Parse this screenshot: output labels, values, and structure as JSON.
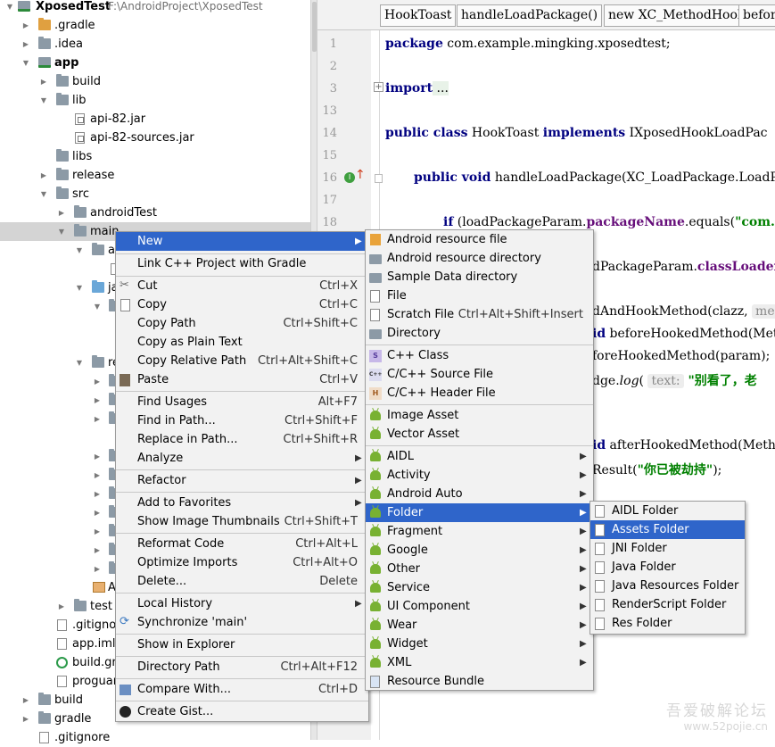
{
  "project": {
    "root_name": "XposedTest",
    "root_path": "F:\\AndroidProject\\XposedTest",
    "rows": [
      {
        "label": ".gradle"
      },
      {
        "label": ".idea"
      },
      {
        "label": "app"
      },
      {
        "label": "build"
      },
      {
        "label": "lib"
      },
      {
        "label": "api-82.jar"
      },
      {
        "label": "api-82-sources.jar"
      },
      {
        "label": "libs"
      },
      {
        "label": "release"
      },
      {
        "label": "src"
      },
      {
        "label": "androidTest"
      },
      {
        "label": "main"
      },
      {
        "label": "a"
      },
      {
        "label": "ja"
      },
      {
        "label": "re"
      },
      {
        "label": "A"
      },
      {
        "label": "test"
      },
      {
        "label": ".gitignor"
      },
      {
        "label": "app.iml"
      },
      {
        "label": "build.gra"
      },
      {
        "label": "proguar"
      },
      {
        "label": "build"
      },
      {
        "label": "gradle"
      },
      {
        "label": ".gitignore"
      }
    ]
  },
  "editor": {
    "tabs": [
      "HookToast",
      "handleLoadPackage()",
      "new XC_MethodHook",
      "before"
    ],
    "line_numbers": [
      "1",
      "2",
      "3",
      "13",
      "14",
      "15",
      "16",
      "17",
      "18"
    ],
    "code": {
      "l1_kw": "package",
      "l1_rest": " com.example.mingking.xposedtest;",
      "l3_kw": "import",
      "l3_rest": " ...",
      "l14_kw1": "public class",
      "l14_mid": " HookToast ",
      "l14_kw2": "implements",
      "l14_rest": " IXposedHookLoadPac",
      "l16_kw": "public void",
      "l16_rest": " handleLoadPackage(XC_LoadPackage.LoadP",
      "l18_kw": "if",
      "l18_a": " (loadPackageParam.",
      "l18_fld": "packageName",
      "l18_b": ".equals(",
      "l18_str": "\"com.",
      "c1_a": "dPackageParam.",
      "c1_fld": "classLoader",
      "c2_a": "dAndHookMethod(clazz, ",
      "c2_hint": "me",
      "c3_kw": "id",
      "c3_rest": " beforeHookedMethod(Met",
      "c4_rest": "foreHookedMethod(param);",
      "c5_a": "dge.",
      "c5_it": "log",
      "c5_b": "( ",
      "c5_hint": "text:",
      "c5_str": " \"别看了，老",
      "c6_kw": "id",
      "c6_rest": " afterHookedMethod(Meth",
      "c7_a": "Result(",
      "c7_str": "\"你已被劫持\"",
      "c7_b": ");"
    }
  },
  "context_menu": {
    "items": [
      {
        "label": "New",
        "shortcut": ""
      },
      {
        "label": "Link C++ Project with Gradle",
        "shortcut": ""
      },
      {
        "label": "Cut",
        "shortcut": "Ctrl+X"
      },
      {
        "label": "Copy",
        "shortcut": "Ctrl+C"
      },
      {
        "label": "Copy Path",
        "shortcut": "Ctrl+Shift+C"
      },
      {
        "label": "Copy as Plain Text",
        "shortcut": ""
      },
      {
        "label": "Copy Relative Path",
        "shortcut": "Ctrl+Alt+Shift+C"
      },
      {
        "label": "Paste",
        "shortcut": "Ctrl+V"
      },
      {
        "label": "Find Usages",
        "shortcut": "Alt+F7"
      },
      {
        "label": "Find in Path...",
        "shortcut": "Ctrl+Shift+F"
      },
      {
        "label": "Replace in Path...",
        "shortcut": "Ctrl+Shift+R"
      },
      {
        "label": "Analyze",
        "shortcut": ""
      },
      {
        "label": "Refactor",
        "shortcut": ""
      },
      {
        "label": "Add to Favorites",
        "shortcut": ""
      },
      {
        "label": "Show Image Thumbnails",
        "shortcut": "Ctrl+Shift+T"
      },
      {
        "label": "Reformat Code",
        "shortcut": "Ctrl+Alt+L"
      },
      {
        "label": "Optimize Imports",
        "shortcut": "Ctrl+Alt+O"
      },
      {
        "label": "Delete...",
        "shortcut": "Delete"
      },
      {
        "label": "Local History",
        "shortcut": ""
      },
      {
        "label": "Synchronize 'main'",
        "shortcut": ""
      },
      {
        "label": "Show in Explorer",
        "shortcut": ""
      },
      {
        "label": "Directory Path",
        "shortcut": "Ctrl+Alt+F12"
      },
      {
        "label": "Compare With...",
        "shortcut": "Ctrl+D"
      },
      {
        "label": "Create Gist...",
        "shortcut": ""
      }
    ]
  },
  "new_submenu": {
    "items": [
      {
        "label": "Android resource file",
        "shortcut": ""
      },
      {
        "label": "Android resource directory",
        "shortcut": ""
      },
      {
        "label": "Sample Data directory",
        "shortcut": ""
      },
      {
        "label": "File",
        "shortcut": ""
      },
      {
        "label": "Scratch File",
        "shortcut": "Ctrl+Alt+Shift+Insert"
      },
      {
        "label": "Directory",
        "shortcut": ""
      },
      {
        "label": "C++ Class",
        "shortcut": ""
      },
      {
        "label": "C/C++ Source File",
        "shortcut": ""
      },
      {
        "label": "C/C++ Header File",
        "shortcut": ""
      },
      {
        "label": "Image Asset",
        "shortcut": ""
      },
      {
        "label": "Vector Asset",
        "shortcut": ""
      },
      {
        "label": "AIDL",
        "shortcut": ""
      },
      {
        "label": "Activity",
        "shortcut": ""
      },
      {
        "label": "Android Auto",
        "shortcut": ""
      },
      {
        "label": "Folder",
        "shortcut": ""
      },
      {
        "label": "Fragment",
        "shortcut": ""
      },
      {
        "label": "Google",
        "shortcut": ""
      },
      {
        "label": "Other",
        "shortcut": ""
      },
      {
        "label": "Service",
        "shortcut": ""
      },
      {
        "label": "UI Component",
        "shortcut": ""
      },
      {
        "label": "Wear",
        "shortcut": ""
      },
      {
        "label": "Widget",
        "shortcut": ""
      },
      {
        "label": "XML",
        "shortcut": ""
      },
      {
        "label": "Resource Bundle",
        "shortcut": ""
      }
    ]
  },
  "folder_submenu": {
    "items": [
      {
        "label": "AIDL Folder"
      },
      {
        "label": "Assets Folder"
      },
      {
        "label": "JNI Folder"
      },
      {
        "label": "Java Folder"
      },
      {
        "label": "Java Resources Folder"
      },
      {
        "label": "RenderScript Folder"
      },
      {
        "label": "Res Folder"
      }
    ]
  },
  "watermark": {
    "line1": "吾爱破解论坛",
    "line2": "www.52pojie.cn"
  },
  "colors": {
    "selection": "#2f65ca",
    "tree_selection": "#d4d4d4",
    "keyword": "#000080",
    "string": "#008000",
    "field": "#660e7a",
    "android": "#78b132"
  }
}
